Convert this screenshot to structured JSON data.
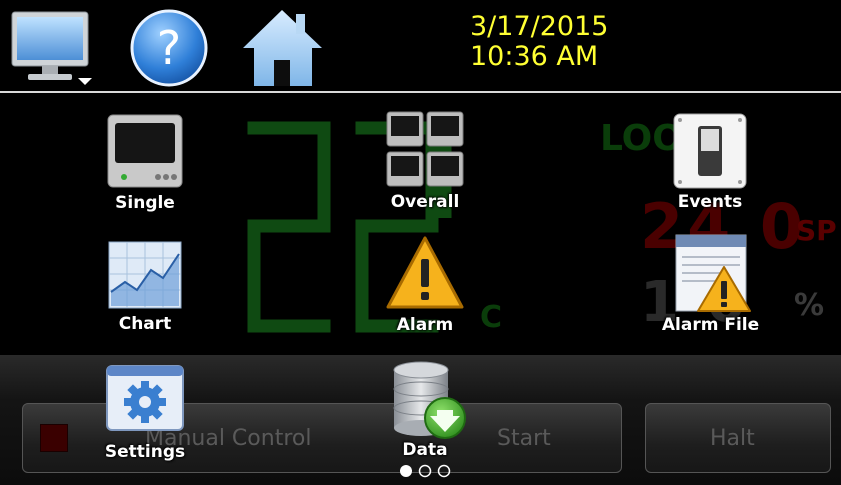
{
  "header": {
    "date": "3/17/2015",
    "time": "10:36 AM",
    "icons": [
      "monitor-icon",
      "help-icon",
      "home-icon"
    ],
    "date_color": "#ffff33"
  },
  "background": {
    "loop_label": "LOO",
    "pv_unit": "C",
    "sp_value": "24 0",
    "sp_unit": "SP",
    "pct_value": "1  0",
    "pct_unit": "%"
  },
  "menu": {
    "single": "Single",
    "overall": "Overall",
    "events": "Events",
    "chart": "Chart",
    "alarm": "Alarm",
    "alarm_file": "Alarm File",
    "settings": "Settings",
    "data": "Data"
  },
  "controls": {
    "manual": "Manual Control",
    "start": "Start",
    "halt": "Halt"
  },
  "pager": {
    "pages": 3,
    "current": 1
  }
}
